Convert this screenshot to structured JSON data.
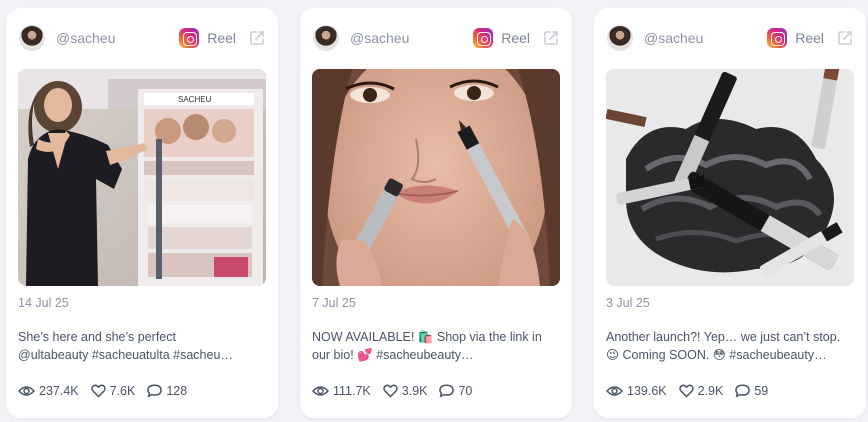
{
  "posts": [
    {
      "handle": "@sacheu",
      "platform_label": "Reel",
      "date": "14 Jul 25",
      "caption_line1": "She’s here and she’s perfect",
      "caption_line2": "@ultabeauty #sacheuatulta #sacheu…",
      "views": "237.4K",
      "likes": "7.6K",
      "comments": "128"
    },
    {
      "handle": "@sacheu",
      "platform_label": "Reel",
      "date": "7 Jul 25",
      "caption_line1": "NOW AVAILABLE! 🛍️ Shop via the link in",
      "caption_line2": "our bio! 💕 #sacheubeauty…",
      "views": "111.7K",
      "likes": "3.9K",
      "comments": "70"
    },
    {
      "handle": "@sacheu",
      "platform_label": "Reel",
      "date": "3 Jul 25",
      "caption_line1": "Another launch?! Yep… we just can’t stop.",
      "caption_line2": "😉 Coming SOON. 😳 #sacheubeauty…",
      "views": "139.6K",
      "likes": "2.9K",
      "comments": "59"
    }
  ],
  "icons": {
    "platform": "instagram-icon",
    "external": "external-link-icon",
    "views": "eye-icon",
    "likes": "heart-icon",
    "comments": "comment-icon"
  },
  "colors": {
    "background": "#f1f3f7",
    "card": "#ffffff",
    "muted_text": "#8b93a4",
    "body_text": "#4a5468"
  }
}
